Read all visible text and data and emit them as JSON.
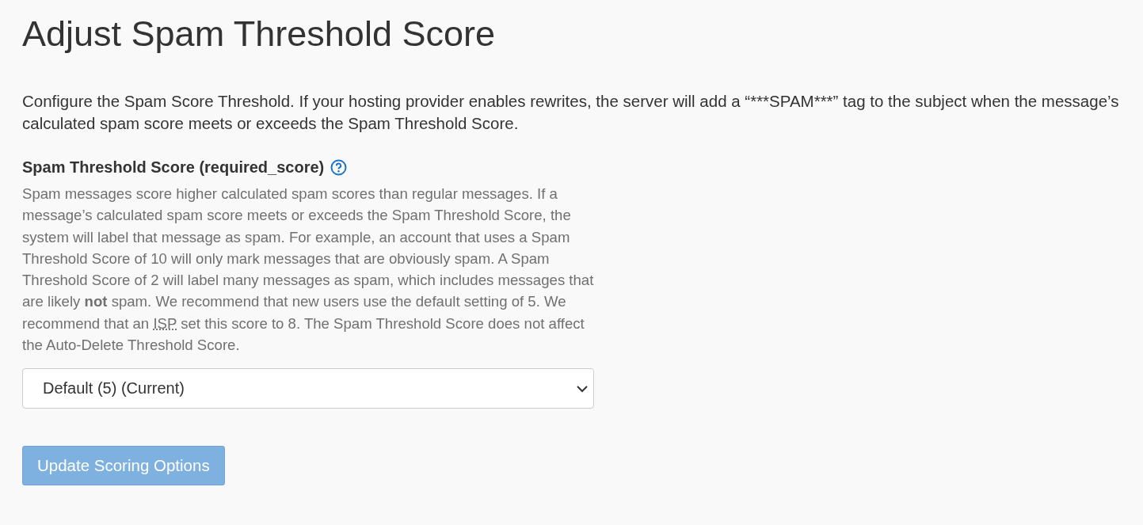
{
  "title": "Adjust Spam Threshold Score",
  "intro": "Configure the Spam Score Threshold. If your hosting provider enables rewrites, the server will add a “***SPAM***” tag to the subject when the message’s calculated spam score meets or exceeds the Spam Threshold Score.",
  "field": {
    "label": "Spam Threshold Score (required_score)",
    "help_icon": true,
    "help_before": "Spam messages score higher calculated spam scores than regular messages. If a message’s calculated spam score meets or exceeds the Spam Threshold Score, the system will label that message as spam. For example, an account that uses a Spam Threshold Score of 10 will only mark messages that are obviously spam. A Spam Threshold Score of 2 will label many messages as spam, which includes messages that are likely **not** spam. We recommend that new users use the default setting of 5. We recommend that an",
    "help_abbr": "ISP",
    "help_after": "set this score to 8. The Spam Threshold Score does not affect the Auto-Delete Threshold Score.",
    "value": "Default (5) (Current)"
  },
  "button": {
    "label": "Update Scoring Options",
    "disabled": true
  }
}
